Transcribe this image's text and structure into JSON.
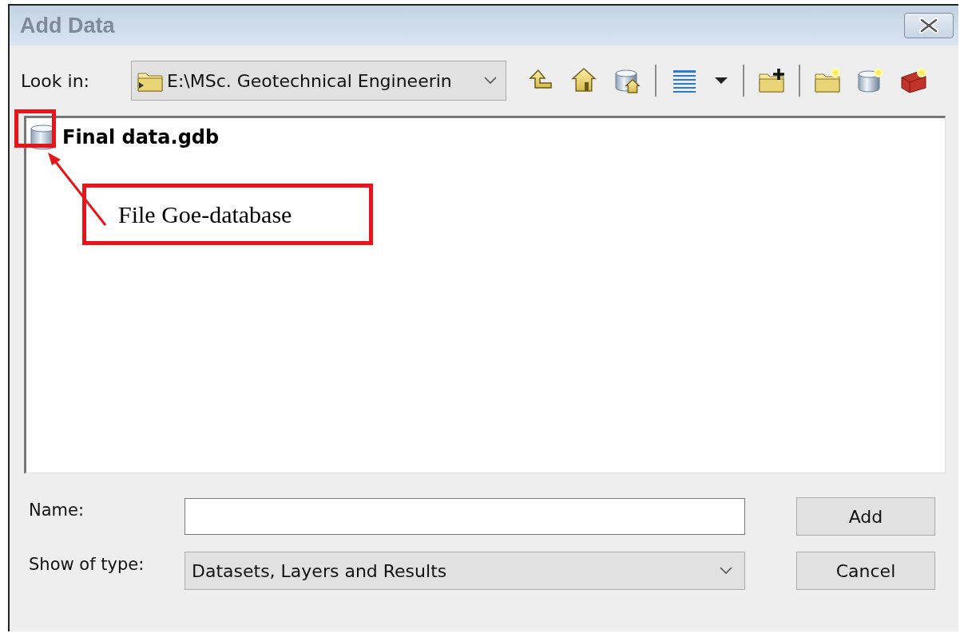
{
  "window": {
    "title": "Add Data"
  },
  "look_in": {
    "label": "Look in:",
    "value": "E:\\MSc. Geotechnical Engineerin"
  },
  "items": [
    {
      "name": "Final data.gdb",
      "kind": "geodatabase"
    }
  ],
  "annotation": {
    "label": "File Goe-database"
  },
  "name_field": {
    "label": "Name:"
  },
  "type_field": {
    "label": "Show of type:",
    "value": "Datasets, Layers and Results"
  },
  "buttons": [
    "Add",
    "Cancel"
  ]
}
